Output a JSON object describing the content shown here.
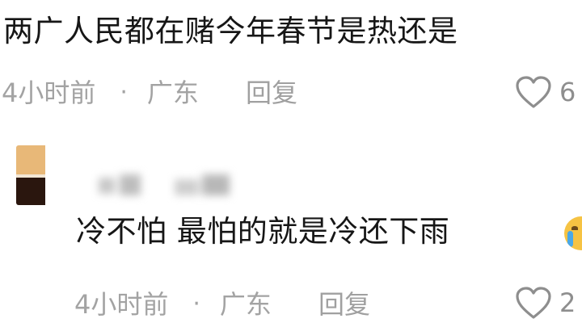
{
  "comments": [
    {
      "text": "两广人民都在赌今年春节是热还是",
      "time": "4小时前",
      "separator": "·",
      "location": "广东",
      "reply_label": "回复",
      "like_count": "6"
    },
    {
      "text": "冷不怕 最怕的就是冷还下雨",
      "time": "4小时前",
      "separator": "·",
      "location": "广东",
      "reply_label": "回复",
      "like_count": "2"
    }
  ],
  "icons": {
    "like": "heart-outline-icon",
    "emoji": "crying-face-emoji"
  },
  "colors": {
    "text": "#161616",
    "meta": "#a3a3a3",
    "icon": "#8e8e8e",
    "background": "#ffffff"
  }
}
